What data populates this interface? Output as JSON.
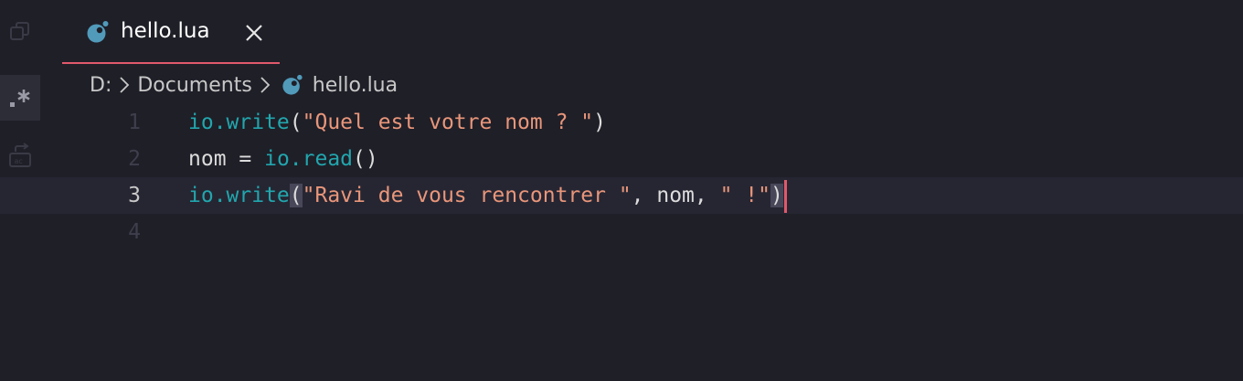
{
  "tab": {
    "label": "hello.lua",
    "close_icon": "close-icon",
    "file_icon": "lua-file-icon"
  },
  "breadcrumb": {
    "items": [
      "D:",
      "Documents",
      "hello.lua"
    ],
    "separator_icon": "chevron-right-icon"
  },
  "editor": {
    "language": "lua",
    "current_line": 3,
    "lines": [
      {
        "number": "1",
        "tokens": [
          {
            "text": "io.write",
            "kind": "fn"
          },
          {
            "text": "(",
            "kind": "punc"
          },
          {
            "text": "\"Quel est votre nom ? \"",
            "kind": "str"
          },
          {
            "text": ")",
            "kind": "punc"
          }
        ]
      },
      {
        "number": "2",
        "tokens": [
          {
            "text": "nom = ",
            "kind": "id"
          },
          {
            "text": "io.read",
            "kind": "fn"
          },
          {
            "text": "()",
            "kind": "punc"
          }
        ]
      },
      {
        "number": "3",
        "tokens": [
          {
            "text": "io.write",
            "kind": "fn"
          },
          {
            "text": "(",
            "kind": "punc",
            "matched": true
          },
          {
            "text": "\"Ravi de vous rencontrer \"",
            "kind": "str"
          },
          {
            "text": ", nom, ",
            "kind": "punc"
          },
          {
            "text": "\" !\"",
            "kind": "str"
          },
          {
            "text": ")",
            "kind": "punc",
            "matched": true
          }
        ]
      },
      {
        "number": "4",
        "tokens": []
      }
    ]
  },
  "activity_bar": {
    "icons": [
      "copy-icon",
      "regex-icon",
      "replace-icon",
      "more-icon"
    ],
    "active": "regex-icon"
  },
  "colors": {
    "background": "#1f1f28",
    "accent": "#e0596c",
    "function": "#22a6ad",
    "string": "#e9967a",
    "file_icon": "#519aba"
  }
}
